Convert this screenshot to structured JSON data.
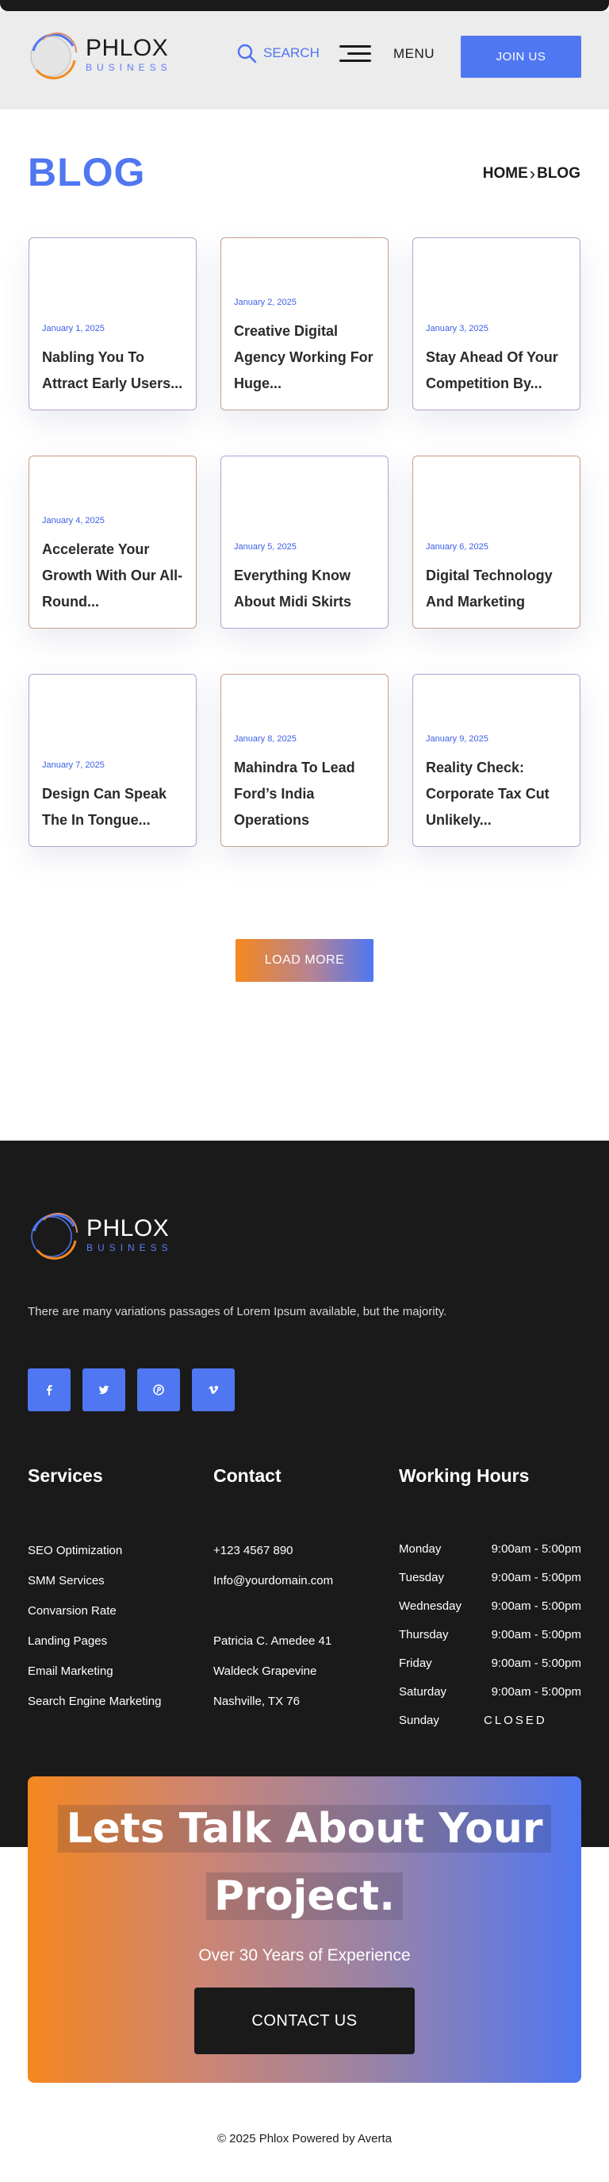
{
  "header": {
    "logo": {
      "brand": "PHLOX",
      "sub": "BUSINESS"
    },
    "search_label": "SEARCH",
    "menu_label": "MENU",
    "join_label": "JOIN US"
  },
  "page": {
    "title": "BLOG",
    "breadcrumb": {
      "home": "HOME",
      "current": "BLOG"
    }
  },
  "posts": [
    {
      "date": "January 1, 2025",
      "title": "Nabling You To Attract Early Users..."
    },
    {
      "date": "January 2, 2025",
      "title": "Creative Digital Agency Working For Huge..."
    },
    {
      "date": "January 3, 2025",
      "title": "Stay Ahead Of Your Competition By..."
    },
    {
      "date": "January 4, 2025",
      "title": "Accelerate Your Growth With Our All-Round..."
    },
    {
      "date": "January 5, 2025",
      "title": "Everything Know About Midi Skirts"
    },
    {
      "date": "January 6, 2025",
      "title": "Digital Technology And Marketing"
    },
    {
      "date": "January 7, 2025",
      "title": "Design Can Speak The In Tongue..."
    },
    {
      "date": "January 8, 2025",
      "title": "Mahindra To Lead Ford’s India Operations"
    },
    {
      "date": "January 9, 2025",
      "title": "Reality Check: Corporate Tax Cut Unlikely..."
    }
  ],
  "load_more_label": "LOAD MORE",
  "footer": {
    "logo": {
      "brand": "PHLOX",
      "sub": "BUSINESS"
    },
    "description": "There are many variations passages of Lorem Ipsum available, but the majority.",
    "socials": [
      "facebook-icon",
      "twitter-icon",
      "pinterest-icon",
      "vimeo-icon"
    ],
    "services": {
      "title": "Services",
      "items": [
        "SEO Optimization",
        "SMM Services",
        "Convarsion Rate",
        "Landing Pages",
        "Email Marketing",
        "Search Engine Marketing"
      ]
    },
    "contact": {
      "title": "Contact",
      "phone": "+123 4567 890",
      "email": "Info@yourdomain.com",
      "address": [
        "Patricia C. Amedee 41",
        "Waldeck Grapevine",
        "Nashville, TX 76"
      ]
    },
    "hours": {
      "title": "Working Hours",
      "rows": [
        {
          "day": "Monday",
          "time": "9:00am - 5:00pm"
        },
        {
          "day": "Tuesday",
          "time": "9:00am - 5:00pm"
        },
        {
          "day": "Wednesday",
          "time": "9:00am - 5:00pm"
        },
        {
          "day": "Thursday",
          "time": "9:00am - 5:00pm"
        },
        {
          "day": "Friday",
          "time": "9:00am - 5:00pm"
        },
        {
          "day": "Saturday",
          "time": "9:00am - 5:00pm"
        },
        {
          "day": "Sunday",
          "time": "CLOSED"
        }
      ]
    }
  },
  "cta": {
    "heading_line1": "Lets Talk About Your",
    "heading_line2": "Project.",
    "subheading": "Over 30 Years of Experience",
    "button_label": "CONTACT US"
  },
  "copyright": "© 2025 Phlox Powered by Averta",
  "colors": {
    "accent": "#5077f2",
    "orange": "#f5881f",
    "dark": "#1a1a1a"
  }
}
